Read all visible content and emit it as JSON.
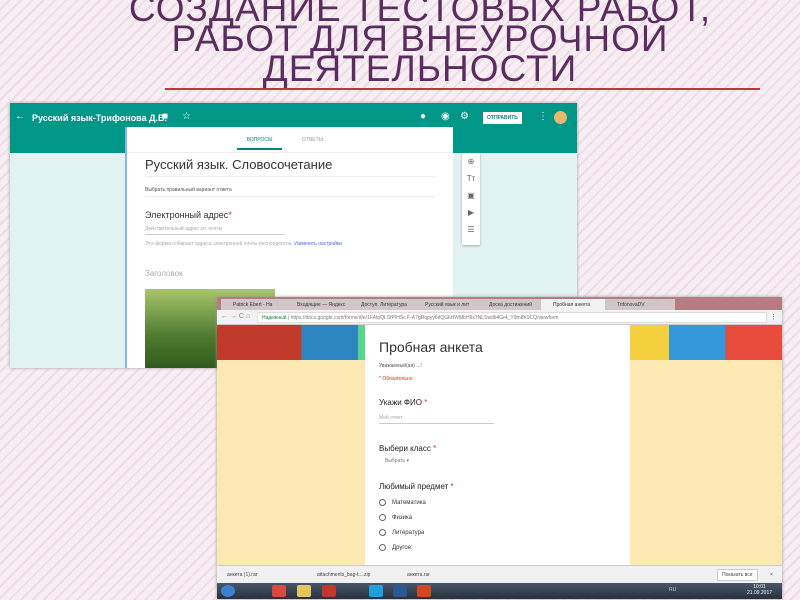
{
  "slide": {
    "title_lines": [
      "СОЗДАНИЕ ТЕСТОВЫХ РАБОТ,",
      "РАБОТ ДЛЯ ВНЕУРОЧНОЙ",
      "ДЕЯТЕЛЬНОСТИ"
    ]
  },
  "editor": {
    "doc_title": "Русский язык-Трифонова Д.В.",
    "send": "ОТПРАВИТЬ",
    "tabs": [
      "ВОПРОСЫ",
      "ОТВЕТЫ"
    ],
    "form_title": "Русский язык. Словосочетание",
    "description": "Выбрать правильный вариант ответа",
    "email_label": "Электронный адрес",
    "email_placeholder": "Действительный адрес эл. почты",
    "email_note": "Эта форма собирает адреса электронной почты респондентов.",
    "email_link": "Изменить настройки",
    "section": "Заголовок",
    "side_tools": [
      "⊕",
      "Tт",
      "▣",
      "▶",
      "☰"
    ]
  },
  "browser": {
    "tabs": [
      "Patrick Ebert - Ha",
      "Входящие — Яндекс",
      "Доступ. Литература",
      "Русский язык и лит",
      "Доска достижений",
      "Пробная анкета",
      "TrifonovaDV"
    ],
    "secure": "Надежный",
    "url": "https://docs.google.com/forms/d/e/1FAIpQLSfPIHSc F-A7gRqpyy6dQGkHWMbH9x7NLSwdb4Gr4_Y9m8K9CQ/viewform",
    "form": {
      "title": "Пробная анкета",
      "greeting": "Уважаемый(ая) ...!",
      "required": "* Обязательно",
      "q1": "Укажи ФИО",
      "q1_placeholder": "Мой ответ",
      "q2": "Выбери класс",
      "q2_select": "Выбрать",
      "q3": "Любимый предмет",
      "options": [
        "Математика",
        "Физика",
        "Литература",
        "Другое:"
      ]
    },
    "downloads": [
      "анкета (1).rar",
      "attachments_bag-t....zip",
      "анкета.rar"
    ],
    "show_all": "Показать все",
    "clock": {
      "time": "10:01",
      "date": "21.09.2017"
    },
    "lang": "RU"
  }
}
